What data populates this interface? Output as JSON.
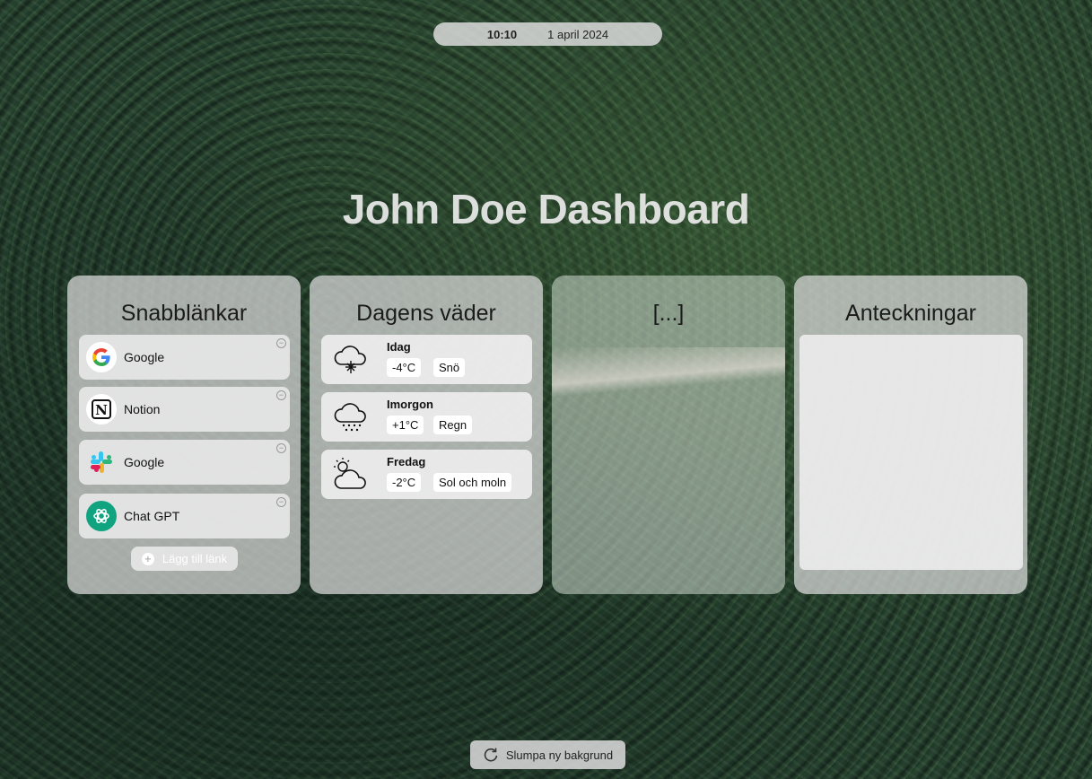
{
  "header": {
    "time": "10:10",
    "date": "1 april 2024"
  },
  "title": "John Doe Dashboard",
  "links_card": {
    "title": "Snabblänkar",
    "items": [
      {
        "label": "Google",
        "icon": "google-icon"
      },
      {
        "label": "Notion",
        "icon": "notion-icon"
      },
      {
        "label": "Google",
        "icon": "slack-icon"
      },
      {
        "label": "Chat GPT",
        "icon": "chatgpt-icon"
      }
    ],
    "add_label": "Lägg till länk"
  },
  "weather_card": {
    "title": "Dagens väder",
    "days": [
      {
        "day": "Idag",
        "temp": "-4°C",
        "condition": "Snö",
        "icon": "snow-cloud-icon"
      },
      {
        "day": "Imorgon",
        "temp": "+1°C",
        "condition": "Regn",
        "icon": "rain-cloud-icon"
      },
      {
        "day": "Fredag",
        "temp": "-2°C",
        "condition": "Sol och moln",
        "icon": "sun-cloud-icon"
      }
    ]
  },
  "placeholder_card": {
    "title": "[...]"
  },
  "notes_card": {
    "title": "Anteckningar",
    "content": ""
  },
  "background_button": {
    "label": "Slumpa ny bakgrund",
    "icon": "refresh-icon"
  }
}
